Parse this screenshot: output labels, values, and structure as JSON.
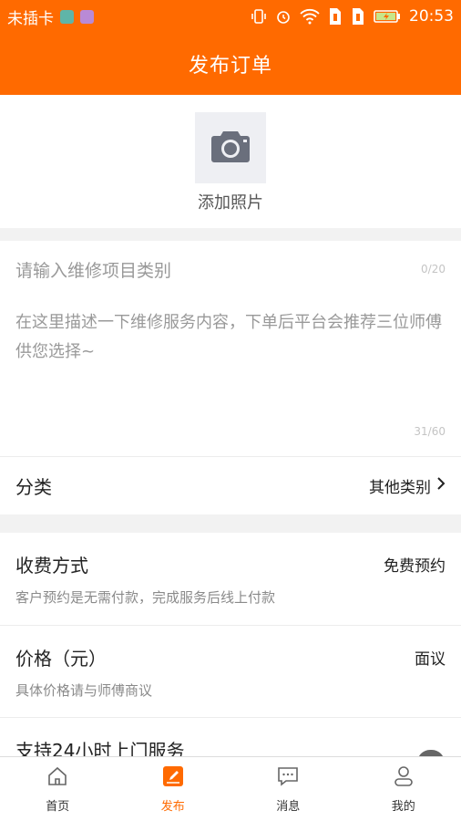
{
  "status_bar": {
    "carrier": "未插卡",
    "time": "20:53"
  },
  "header": {
    "title": "发布订单"
  },
  "photo": {
    "label": "添加照片"
  },
  "description": {
    "category_placeholder": "请输入维修项目类别",
    "category_count": "0/20",
    "text": "在这里描述一下维修服务内容，下单后平台会推荐三位师傅供您选择~",
    "text_count": "31/60"
  },
  "category_row": {
    "label": "分类",
    "value": "其他类别"
  },
  "fee": {
    "label": "收费方式",
    "value": "免费预约",
    "sub": "客户预约是无需付款，完成服务后线上付款"
  },
  "price": {
    "label": "价格（元）",
    "value": "面议",
    "sub": "具体价格请与师傅商议"
  },
  "service": {
    "label": "支持24小时上门服务"
  },
  "tabs": [
    {
      "label": "首页"
    },
    {
      "label": "发布"
    },
    {
      "label": "消息"
    },
    {
      "label": "我的"
    }
  ],
  "colors": {
    "accent": "#ff6a00",
    "background": "#f2f2f2"
  }
}
